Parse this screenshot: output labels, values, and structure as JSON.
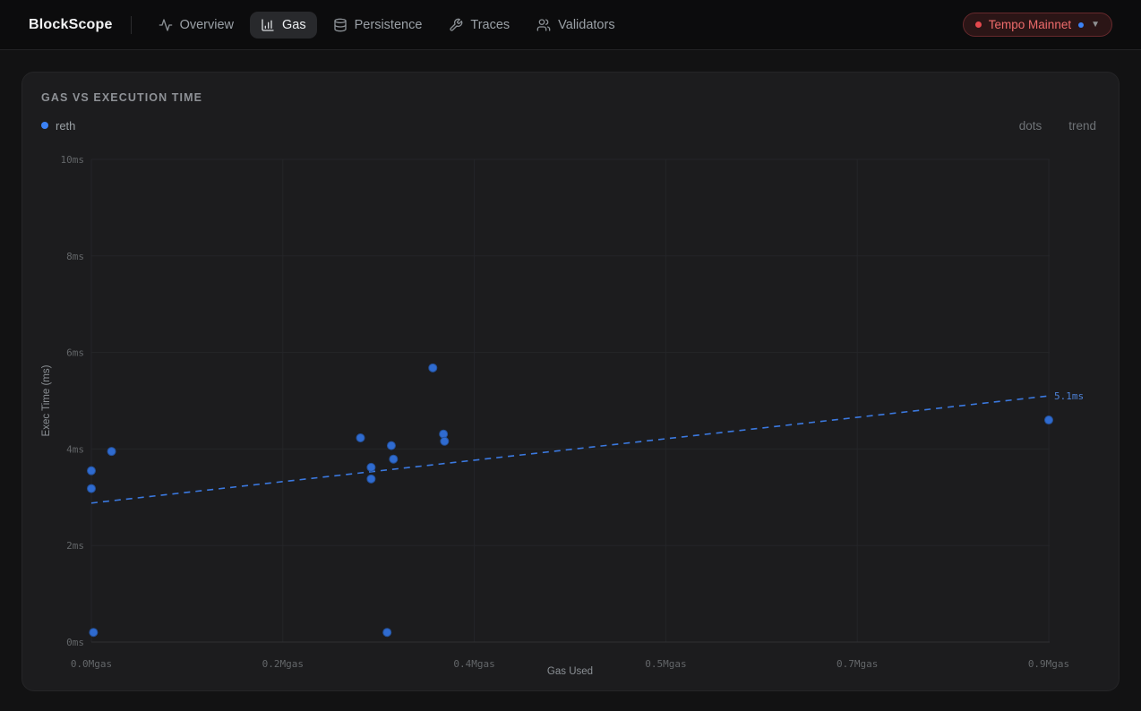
{
  "navbar": {
    "brand": "BlockScope",
    "items": [
      {
        "label": "Overview",
        "icon": "activity-icon",
        "active": false
      },
      {
        "label": "Gas",
        "icon": "bar-chart-icon",
        "active": true
      },
      {
        "label": "Persistence",
        "icon": "database-icon",
        "active": false
      },
      {
        "label": "Traces",
        "icon": "wrench-icon",
        "active": false
      },
      {
        "label": "Validators",
        "icon": "users-icon",
        "active": false
      }
    ],
    "network": {
      "label": "Tempo Mainnet",
      "caret": "▼"
    }
  },
  "card": {
    "title": "GAS VS EXECUTION TIME",
    "legend": {
      "series": "reth"
    },
    "toggles": [
      {
        "label": "dots"
      },
      {
        "label": "trend"
      }
    ]
  },
  "chart_data": {
    "type": "scatter",
    "title": "GAS VS EXECUTION TIME",
    "xlabel": "Gas Used",
    "ylabel": "Exec Time (ms)",
    "xlim": [
      0,
      0.9
    ],
    "ylim": [
      0,
      10
    ],
    "grid": true,
    "legend_position": "top-left",
    "x_ticks": [
      {
        "value": 0.0,
        "label": "0.0Mgas"
      },
      {
        "value": 0.18,
        "label": "0.2Mgas"
      },
      {
        "value": 0.36,
        "label": "0.4Mgas"
      },
      {
        "value": 0.54,
        "label": "0.5Mgas"
      },
      {
        "value": 0.72,
        "label": "0.7Mgas"
      },
      {
        "value": 0.9,
        "label": "0.9Mgas"
      }
    ],
    "y_ticks": [
      {
        "value": 0,
        "label": "0ms"
      },
      {
        "value": 2,
        "label": "2ms"
      },
      {
        "value": 4,
        "label": "4ms"
      },
      {
        "value": 6,
        "label": "6ms"
      },
      {
        "value": 8,
        "label": "8ms"
      },
      {
        "value": 10,
        "label": "10ms"
      }
    ],
    "series": [
      {
        "name": "reth",
        "color": "#3b82f6",
        "points": [
          [
            0.0,
            3.55
          ],
          [
            0.0,
            3.18
          ],
          [
            0.019,
            3.95
          ],
          [
            0.002,
            0.2
          ],
          [
            0.253,
            4.23
          ],
          [
            0.263,
            3.62
          ],
          [
            0.263,
            3.38
          ],
          [
            0.282,
            4.07
          ],
          [
            0.284,
            3.79
          ],
          [
            0.278,
            0.2
          ],
          [
            0.321,
            5.68
          ],
          [
            0.331,
            4.31
          ],
          [
            0.332,
            4.16
          ],
          [
            0.9,
            4.6
          ]
        ]
      }
    ],
    "trend": {
      "type": "linear",
      "style": "dashed",
      "color": "#3b82f6",
      "start": [
        0.0,
        2.88
      ],
      "end": [
        0.9,
        5.1
      ],
      "label": "5.1ms"
    }
  },
  "colors": {
    "accent_blue": "#3b82f6",
    "point_fill": "#2f6bd0",
    "badge_red": "#e5484d",
    "badge_text": "#ee6b6b",
    "card_bg": "#1c1c1e",
    "page_bg": "#121213",
    "navbar_bg": "#0c0c0d"
  }
}
